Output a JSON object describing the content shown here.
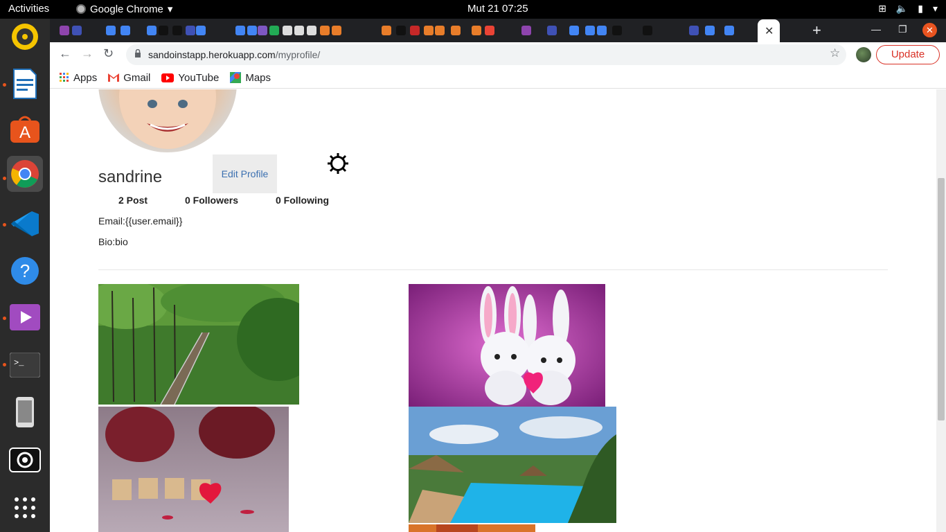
{
  "system": {
    "activities": "Activities",
    "app_name": "Google Chrome",
    "clock": "Mut 21  07:25"
  },
  "browser": {
    "url_host": "sandoinstapp.herokuapp.com",
    "url_path": "/myprofile/",
    "update_label": "Update",
    "bookmarks": [
      {
        "label": "Apps"
      },
      {
        "label": "Gmail"
      },
      {
        "label": "YouTube"
      },
      {
        "label": "Maps"
      }
    ]
  },
  "profile": {
    "username": "sandrine",
    "edit_label": "Edit Profile",
    "posts": "2 Post",
    "followers": "0 Followers",
    "following": "0 Following",
    "email": "Email:{{user.email}}",
    "bio": "Bio:bio"
  },
  "dock": {
    "apps": [
      "rhythmbox-icon",
      "libreoffice-writer-icon",
      "software-center-icon",
      "chrome-icon",
      "vscode-icon",
      "help-icon",
      "video-player-icon",
      "terminal-icon",
      "phone-icon",
      "screenshot-icon",
      "app-grid-icon"
    ]
  },
  "colors": {
    "accent": "#3a6fb0",
    "update_red": "#d93025",
    "ubuntu_orange": "#e95420"
  }
}
